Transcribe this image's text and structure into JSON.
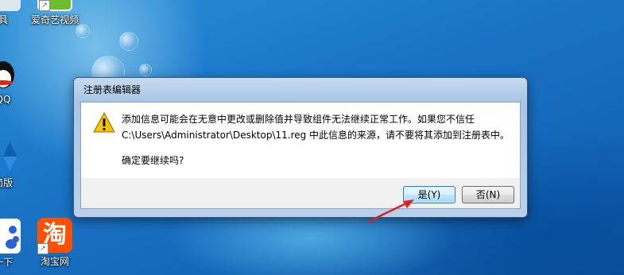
{
  "desktop": {
    "icons": [
      {
        "label": "具",
        "name": "tools"
      },
      {
        "label": "爱奇艺视频",
        "name": "iqiyi"
      },
      {
        "label": "QQ",
        "name": "qq"
      },
      {
        "label": "简版",
        "name": "jianban"
      },
      {
        "label": "一下",
        "name": "yixia"
      },
      {
        "label": "淘宝网",
        "name": "taobao"
      }
    ],
    "taobao_glyph": "淘"
  },
  "dialog": {
    "title": "注册表编辑器",
    "message_line1": "添加信息可能会在无意中更改或删除值并导致组件无法继续正常工作。如果您不信任",
    "message_line2": "C:\\Users\\Administrator\\Desktop\\11.reg 中此信息的来源，请不要将其添加到注册表中。",
    "question": "确定要继续吗?",
    "yes_button": "是(Y)",
    "no_button": "否(N)"
  },
  "colors": {
    "annotation_arrow": "#e02020",
    "warning": "#f5c400"
  }
}
